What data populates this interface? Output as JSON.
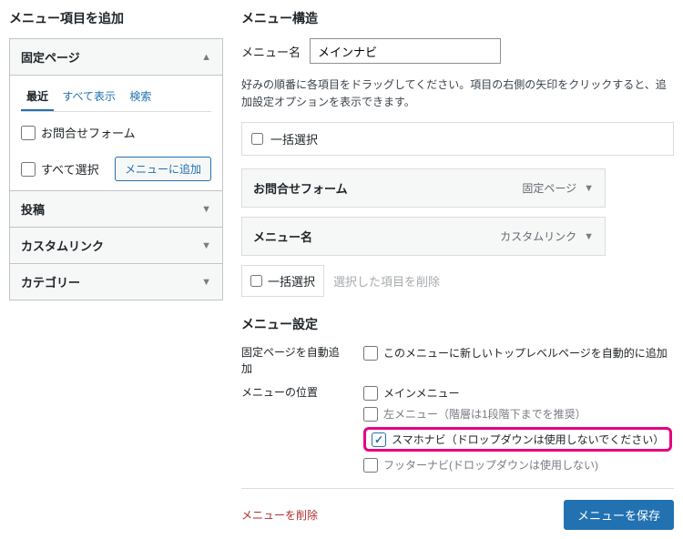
{
  "left": {
    "heading": "メニュー項目を追加",
    "pages": {
      "title": "固定ページ",
      "tabs": {
        "recent": "最近",
        "all": "すべて表示",
        "search": "検索"
      },
      "item1": "お問合せフォーム",
      "select_all": "すべて選択",
      "add_btn": "メニューに追加"
    },
    "posts": "投稿",
    "custom": "カスタムリンク",
    "category": "カテゴリー"
  },
  "right": {
    "heading": "メニュー構造",
    "name_label": "メニュー名",
    "name_value": "メインナビ",
    "help": "好みの順番に各項目をドラッグしてください。項目の右側の矢印をクリックすると、追加設定オプションを表示できます。",
    "bulk_select": "一括選択",
    "items": {
      "i1": {
        "title": "お問合せフォーム",
        "type": "固定ページ"
      },
      "i2": {
        "title": "メニュー名",
        "type": "カスタムリンク"
      }
    },
    "bulk_select2": "一括選択",
    "remove_selected": "選択した項目を削除",
    "settings_heading": "メニュー設定",
    "auto_add_label": "固定ページを自動追加",
    "auto_add_opt": "このメニューに新しいトップレベルページを自動的に追加",
    "location_label": "メニューの位置",
    "loc1": "メインメニュー",
    "loc2": "左メニュー（階層は1段階下までを推奨）",
    "loc3": "スマホナビ（ドロップダウンは使用しないでください）",
    "loc4": "フッターナビ(ドロップダウンは使用しない)",
    "delete_menu": "メニューを削除",
    "save_menu": "メニューを保存"
  }
}
